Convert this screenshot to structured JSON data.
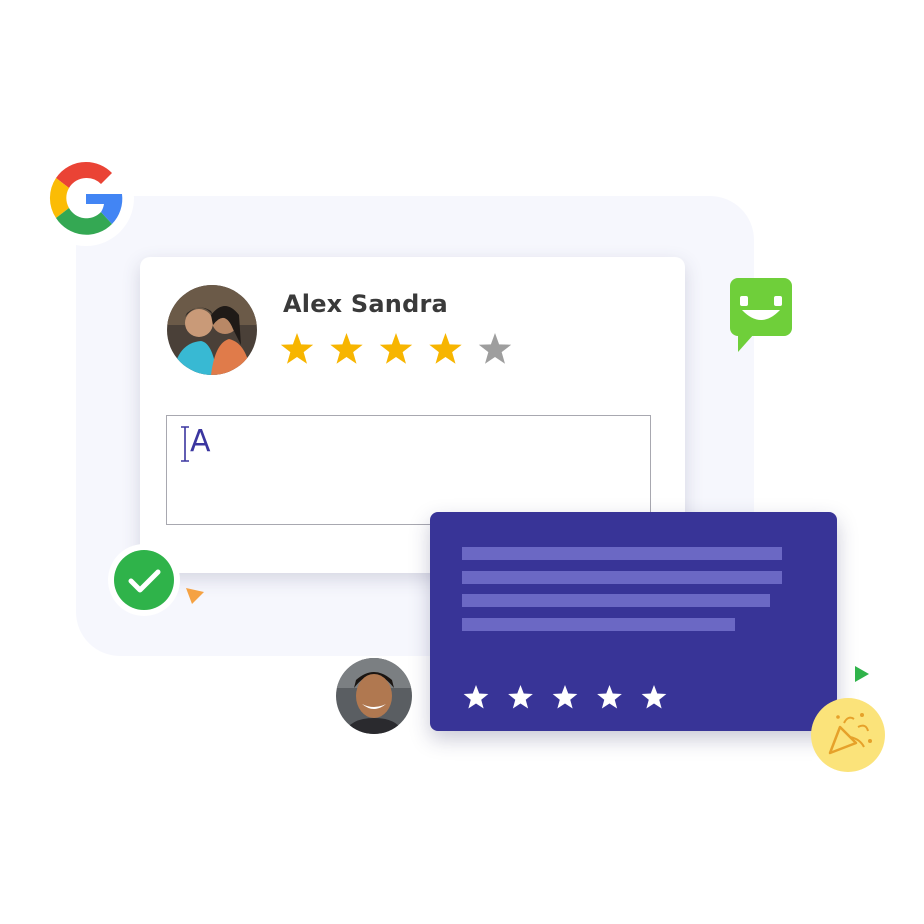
{
  "review": {
    "reviewer_name": "Alex Sandra",
    "rating": 4,
    "max_rating": 5,
    "typed_text": "A"
  },
  "second_review": {
    "rating": 5,
    "max_rating": 5
  },
  "colors": {
    "star_filled": "#f7b500",
    "star_empty": "#9e9e9e",
    "card_purple": "#383497",
    "text_line": "#6b68c4",
    "check_green": "#2fb34a",
    "chat_green": "#6fcf3a",
    "background_panel": "#f6f7fd"
  },
  "icons": [
    "google-logo-icon",
    "chat-bubble-icon",
    "check-icon",
    "party-popper-icon",
    "star-icon",
    "text-cursor-icon"
  ]
}
